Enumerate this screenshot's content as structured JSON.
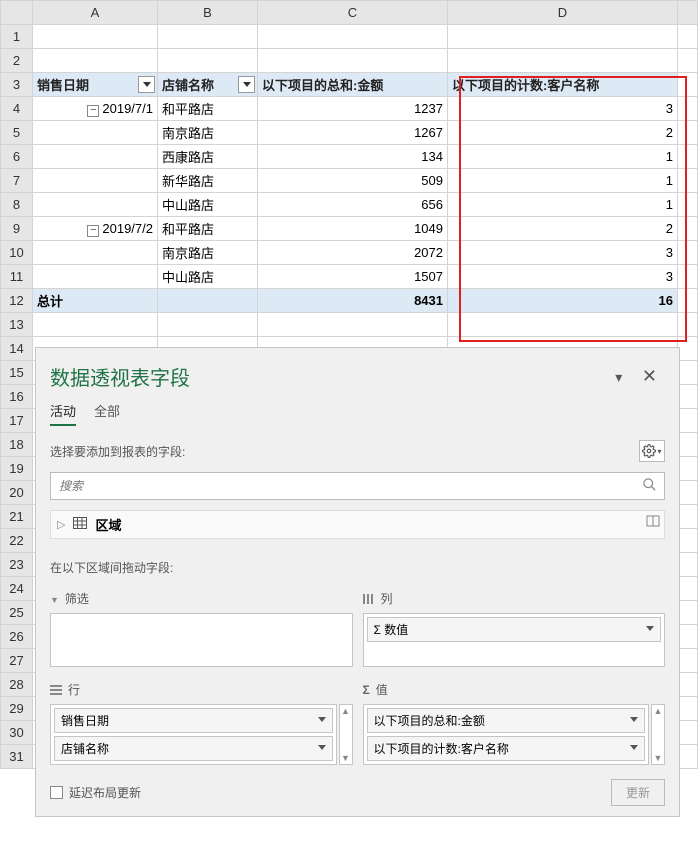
{
  "columns": [
    "A",
    "B",
    "C",
    "D",
    ""
  ],
  "pivot_headers": {
    "date": "销售日期",
    "store": "店铺名称",
    "sum_amount": "以下项目的总和:金额",
    "count_customer": "以下项目的计数:客户名称"
  },
  "rows": [
    {
      "n": 4,
      "date": "2019/7/1",
      "store": "和平路店",
      "sum": "1237",
      "cnt": "3",
      "first": true
    },
    {
      "n": 5,
      "date": "",
      "store": "南京路店",
      "sum": "1267",
      "cnt": "2"
    },
    {
      "n": 6,
      "date": "",
      "store": "西康路店",
      "sum": "134",
      "cnt": "1"
    },
    {
      "n": 7,
      "date": "",
      "store": "新华路店",
      "sum": "509",
      "cnt": "1"
    },
    {
      "n": 8,
      "date": "",
      "store": "中山路店",
      "sum": "656",
      "cnt": "1"
    },
    {
      "n": 9,
      "date": "2019/7/2",
      "store": "和平路店",
      "sum": "1049",
      "cnt": "2",
      "first": true
    },
    {
      "n": 10,
      "date": "",
      "store": "南京路店",
      "sum": "2072",
      "cnt": "3"
    },
    {
      "n": 11,
      "date": "",
      "store": "中山路店",
      "sum": "1507",
      "cnt": "3"
    }
  ],
  "grand_total": {
    "label": "总计",
    "sum": "8431",
    "cnt": "16",
    "n": 12
  },
  "extra_row_nums": [
    13,
    14,
    15,
    16,
    17,
    18,
    19,
    20,
    21,
    22,
    23,
    24,
    25,
    26,
    27,
    28,
    29,
    30,
    31
  ],
  "pane": {
    "title": "数据透视表字段",
    "tab_active": "活动",
    "tab_all": "全部",
    "choose_fields": "选择要添加到报表的字段:",
    "search_placeholder": "搜索",
    "field_area": "区域",
    "drag_label": "在以下区域间拖动字段:",
    "filters_label": "筛选",
    "columns_label": "列",
    "rows_label": "行",
    "values_label": "值",
    "col_item_sigma": "Σ 数值",
    "row_items": [
      "销售日期",
      "店铺名称"
    ],
    "value_items": [
      "以下项目的总和:金额",
      "以下项目的计数:客户名称"
    ],
    "defer_layout": "延迟布局更新",
    "update_btn": "更新"
  }
}
